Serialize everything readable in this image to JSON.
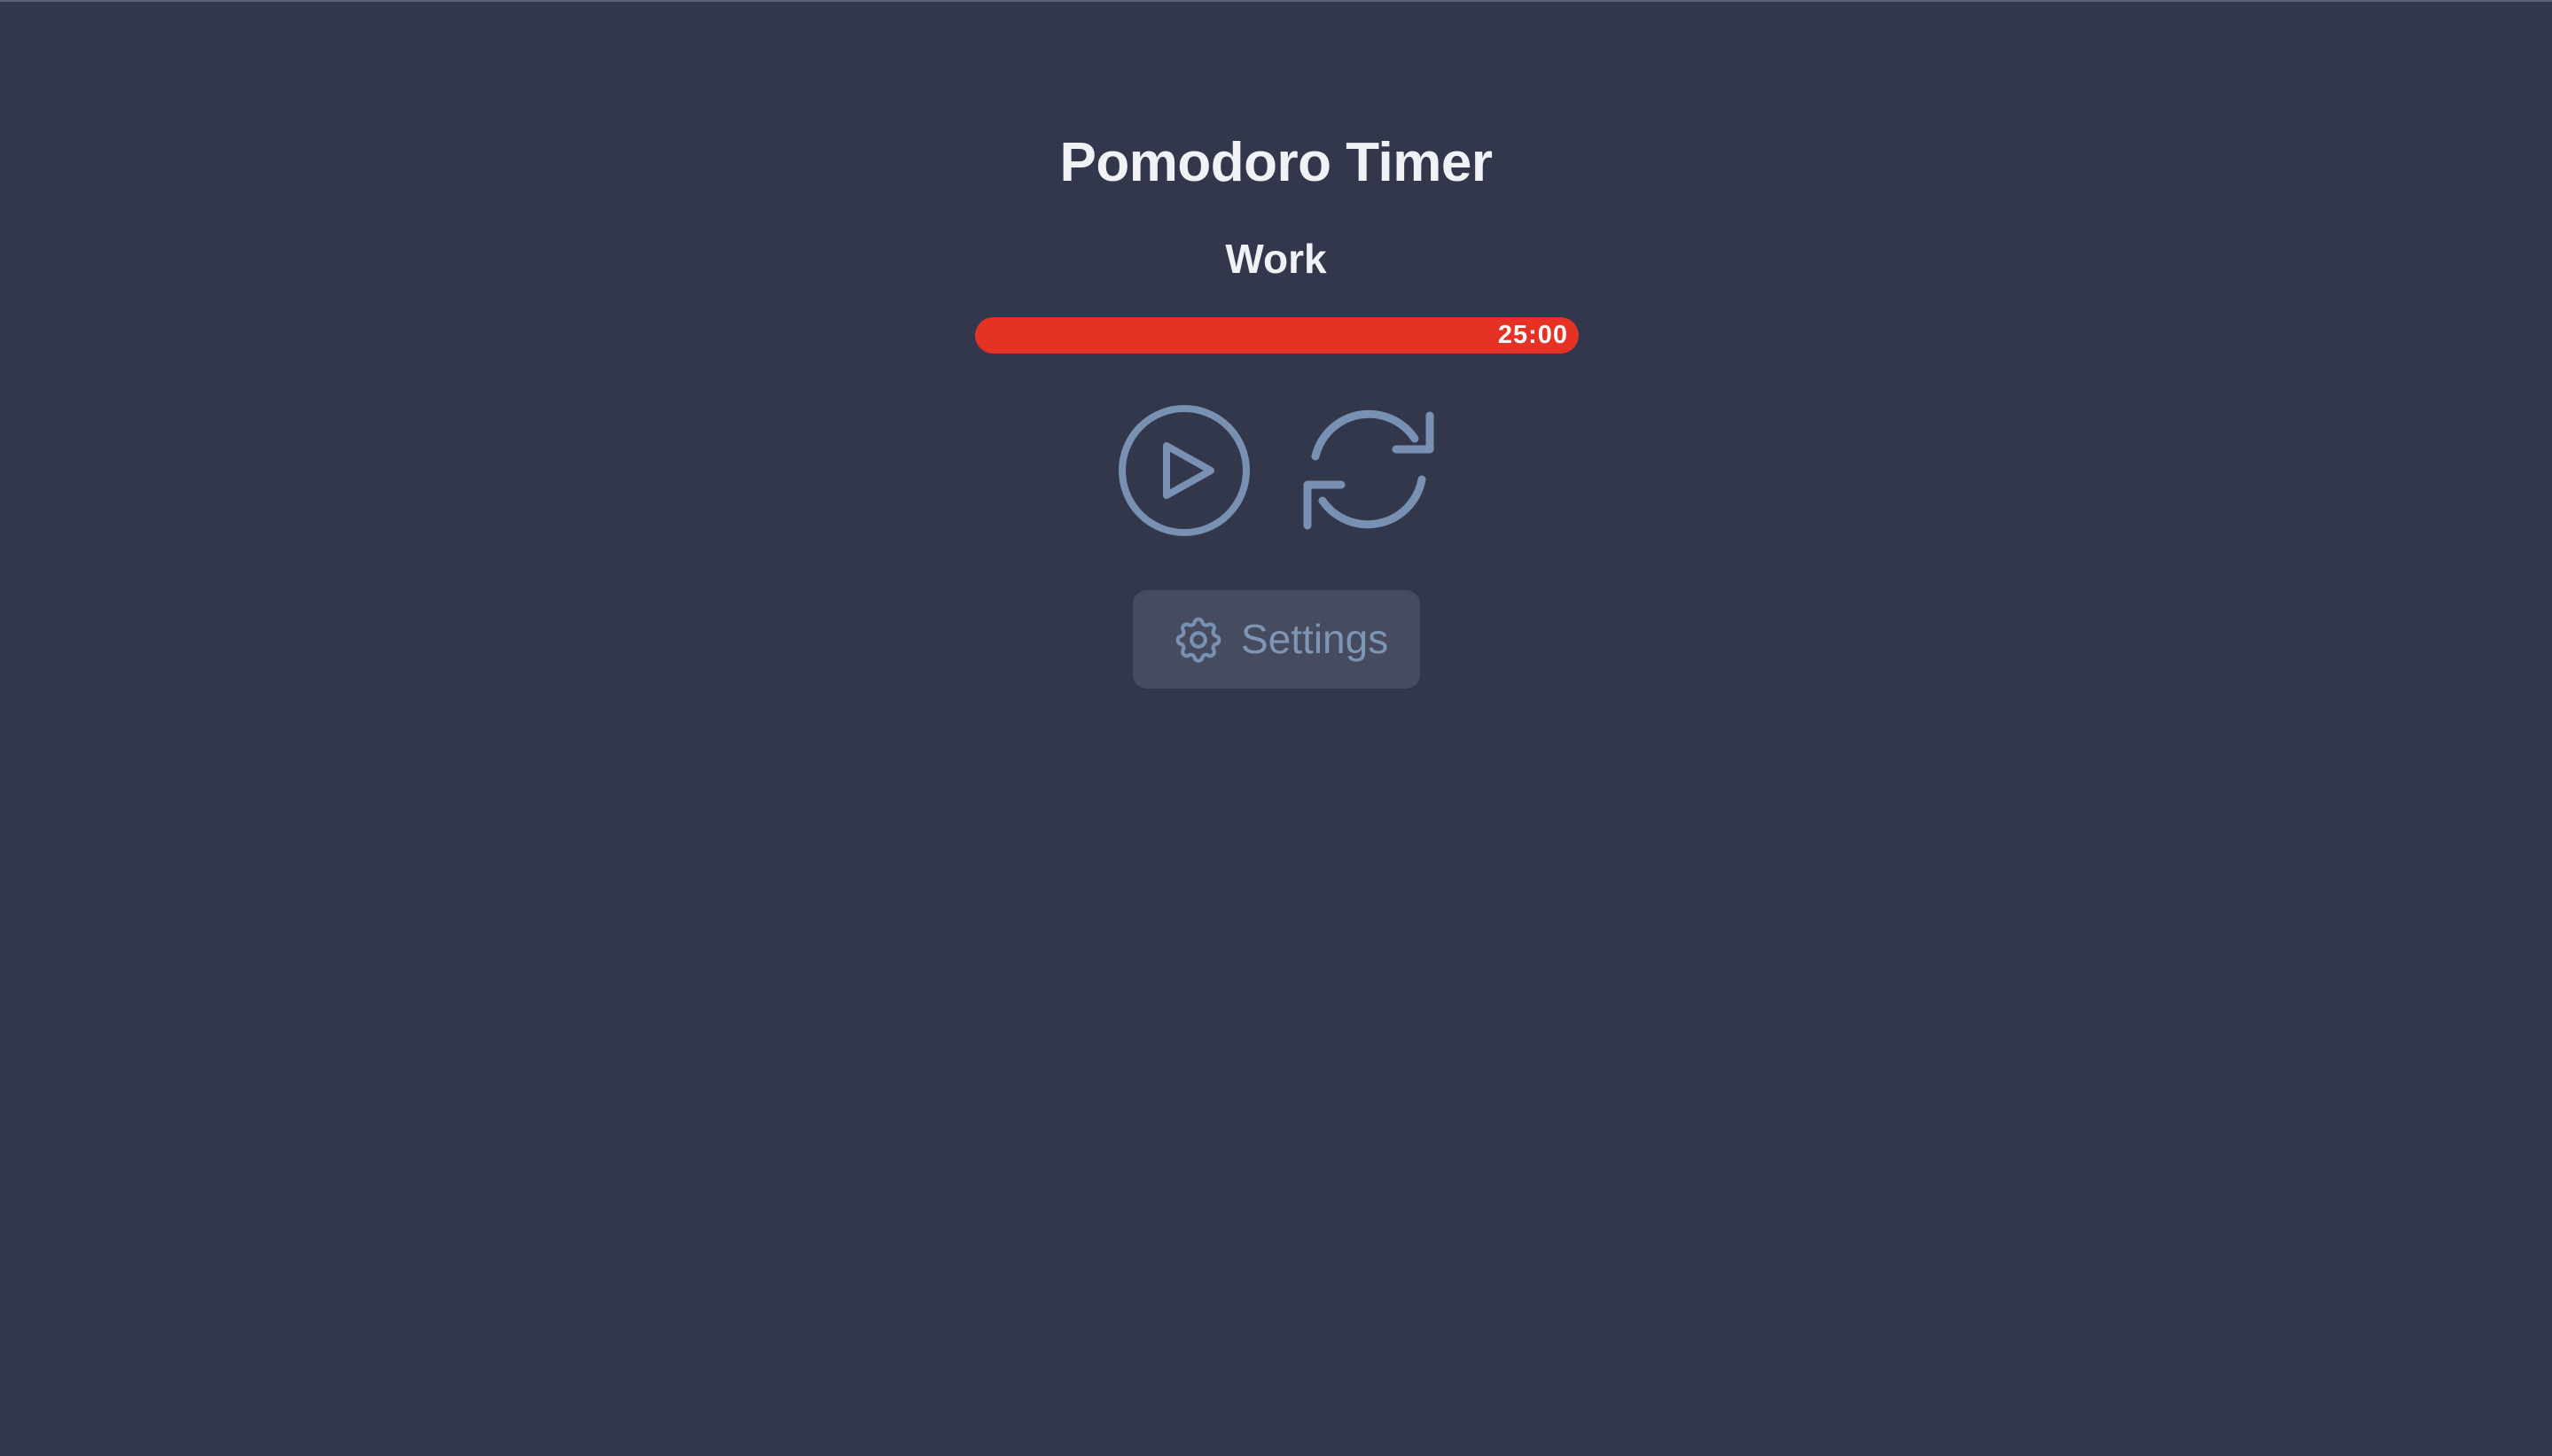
{
  "app": {
    "title": "Pomodoro Timer",
    "mode_label": "Work"
  },
  "timer": {
    "time_remaining": "25:00",
    "progress_fraction": 1.0,
    "progress_color": "#e53225"
  },
  "controls": {
    "play_icon": "play-circle-icon",
    "reset_icon": "refresh-cycle-icon",
    "icon_color": "#7891b3"
  },
  "settings": {
    "label": "Settings",
    "icon": "gear-icon"
  },
  "colors": {
    "background": "#33374b",
    "title_text": "#f1f2f6",
    "settings_text": "#7e95b6",
    "settings_bg": "#464b5f"
  }
}
